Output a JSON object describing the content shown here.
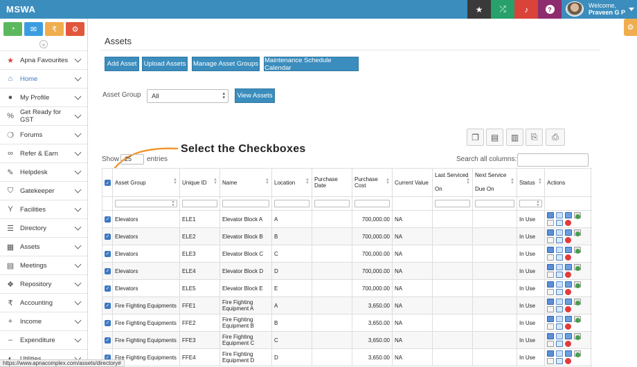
{
  "app": {
    "brand": "MSWA"
  },
  "topbar": {
    "icons": [
      {
        "name": "star-icon",
        "glyph": "★",
        "color": "#3a3a3a"
      },
      {
        "name": "shuffle-icon",
        "glyph": "⤮",
        "color": "#27a06b"
      },
      {
        "name": "bell-icon",
        "glyph": "🔔",
        "color": "#d9433a"
      },
      {
        "name": "help-icon",
        "glyph": "?",
        "color": "#8e2d6e"
      }
    ],
    "welcome": "Welcome,",
    "user_name": "Praveen G P"
  },
  "sidebar": {
    "quick": [
      {
        "name": "dashboard-quick-icon",
        "glyph": "◔",
        "color": "#5cb85c"
      },
      {
        "name": "chat-quick-icon",
        "glyph": "💬",
        "color": "#3b9de0"
      },
      {
        "name": "rupee-quick-icon",
        "glyph": "₹",
        "color": "#f0ad4e"
      },
      {
        "name": "settings-quick-icon",
        "glyph": "⚙",
        "color": "#e2563c"
      }
    ],
    "collapse": "«",
    "items": [
      {
        "label": "Apna Favourites",
        "icon": "star-icon",
        "glyph": "★"
      },
      {
        "label": "Home",
        "icon": "home-icon",
        "glyph": "⌂"
      },
      {
        "label": "My Profile",
        "icon": "user-icon",
        "glyph": "●"
      },
      {
        "label": "Get Ready for GST",
        "icon": "percent-icon",
        "glyph": "%"
      },
      {
        "label": "Forums",
        "icon": "forum-icon",
        "glyph": "❍"
      },
      {
        "label": "Refer & Earn",
        "icon": "handshake-icon",
        "glyph": "∞"
      },
      {
        "label": "Helpdesk",
        "icon": "wrench-icon",
        "glyph": "✎"
      },
      {
        "label": "Gatekeeper",
        "icon": "shield-icon",
        "glyph": "⛉"
      },
      {
        "label": "Facilities",
        "icon": "trophy-icon",
        "glyph": "Y"
      },
      {
        "label": "Directory",
        "icon": "list-icon",
        "glyph": "☰"
      },
      {
        "label": "Assets",
        "icon": "building-icon",
        "glyph": "▦"
      },
      {
        "label": "Meetings",
        "icon": "calendar-icon",
        "glyph": "▤"
      },
      {
        "label": "Repository",
        "icon": "dropbox-icon",
        "glyph": "❖"
      },
      {
        "label": "Accounting",
        "icon": "rupee-icon",
        "glyph": "₹"
      },
      {
        "label": "Income",
        "icon": "plus-icon",
        "glyph": "+"
      },
      {
        "label": "Expenditure",
        "icon": "minus-icon",
        "glyph": "–"
      },
      {
        "label": "Utilities",
        "icon": "utilities-icon",
        "glyph": "◐"
      }
    ]
  },
  "main": {
    "title": "Assets",
    "buttons": {
      "add_asset": "Add Asset",
      "upload_assets": "Upload Assets",
      "manage_groups": "Manage Asset Groups",
      "maintenance_calendar": "Maintenance Schedule Calendar"
    },
    "asset_group_label": "Asset Group",
    "asset_group_value": "All",
    "view_assets": "View Assets",
    "show_label": "Show",
    "entries_value": "25",
    "entries_label": "entries",
    "search_label": "Search all columns:",
    "callout": "Select the Checkboxes"
  },
  "table": {
    "headers": [
      "Asset Group",
      "Unique ID",
      "Name",
      "Location",
      "Purchase Date",
      "Purchase Cost",
      "Current Value",
      "Last Serviced On",
      "Next Service Due On",
      "Status",
      "Actions"
    ],
    "rows": [
      {
        "group": "Elevators",
        "uid": "ELE1",
        "name": "Elevator Block A",
        "location": "A",
        "purchase_date": "",
        "cost": "700,000.00",
        "current": "NA",
        "last": "",
        "next": "",
        "status": "In Use"
      },
      {
        "group": "Elevators",
        "uid": "ELE2",
        "name": "Elevator Block B",
        "location": "B",
        "purchase_date": "",
        "cost": "700,000.00",
        "current": "NA",
        "last": "",
        "next": "",
        "status": "In Use"
      },
      {
        "group": "Elevators",
        "uid": "ELE3",
        "name": "Elevator Block C",
        "location": "C",
        "purchase_date": "",
        "cost": "700,000.00",
        "current": "NA",
        "last": "",
        "next": "",
        "status": "In Use"
      },
      {
        "group": "Elevators",
        "uid": "ELE4",
        "name": "Elevator Block D",
        "location": "D",
        "purchase_date": "",
        "cost": "700,000.00",
        "current": "NA",
        "last": "",
        "next": "",
        "status": "In Use"
      },
      {
        "group": "Elevators",
        "uid": "ELE5",
        "name": "Elevator Block E",
        "location": "E",
        "purchase_date": "",
        "cost": "700,000.00",
        "current": "NA",
        "last": "",
        "next": "",
        "status": "In Use"
      },
      {
        "group": "Fire Fighting Equipments",
        "uid": "FFE1",
        "name": "Fire Fighting Equipment A",
        "location": "A",
        "purchase_date": "",
        "cost": "3,650.00",
        "current": "NA",
        "last": "",
        "next": "",
        "status": "In Use"
      },
      {
        "group": "Fire Fighting Equipments",
        "uid": "FFE2",
        "name": "Fire Fighting Equipment B",
        "location": "B",
        "purchase_date": "",
        "cost": "3,650.00",
        "current": "NA",
        "last": "",
        "next": "",
        "status": "In Use"
      },
      {
        "group": "Fire Fighting Equipments",
        "uid": "FFE3",
        "name": "Fire Fighting Equipment C",
        "location": "C",
        "purchase_date": "",
        "cost": "3,650.00",
        "current": "NA",
        "last": "",
        "next": "",
        "status": "In Use"
      },
      {
        "group": "Fire Fighting Equipments",
        "uid": "FFE4",
        "name": "Fire Fighting Equipment D",
        "location": "D",
        "purchase_date": "",
        "cost": "3,650.00",
        "current": "NA",
        "last": "",
        "next": "",
        "status": "In Use"
      }
    ]
  },
  "statusbar": {
    "url": "https://www.apnacomplex.com/assets/directory#"
  }
}
